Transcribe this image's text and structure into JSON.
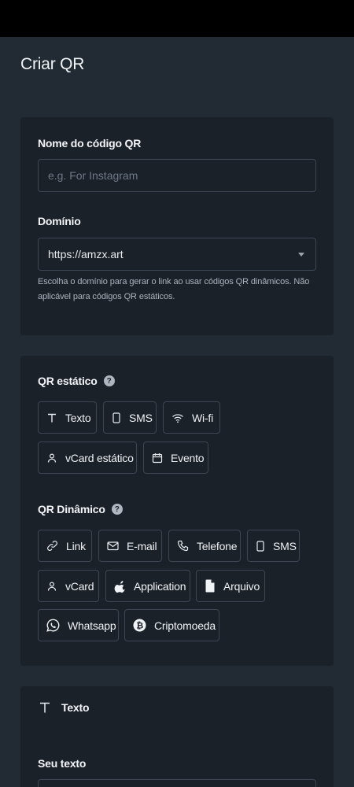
{
  "page": {
    "title": "Criar QR"
  },
  "form": {
    "name_label": "Nome do código QR",
    "name_placeholder": "e.g. For Instagram",
    "domain_label": "Domínio",
    "domain_value": "https://amzx.art",
    "domain_help": "Escolha o domínio para gerar o link ao usar códigos QR dinâmicos. Não aplicável para códigos QR estáticos."
  },
  "static_qr": {
    "title": "QR estático",
    "help_icon": "question-icon",
    "types": [
      {
        "label": "Texto",
        "icon": "text-icon"
      },
      {
        "label": "SMS",
        "icon": "phone-icon"
      },
      {
        "label": "Wi-fi",
        "icon": "wifi-icon"
      },
      {
        "label": "vCard estático",
        "icon": "user-icon"
      },
      {
        "label": "Evento",
        "icon": "calendar-icon"
      }
    ]
  },
  "dynamic_qr": {
    "title": "QR Dinâmico",
    "help_icon": "question-icon",
    "types": [
      {
        "label": "Link",
        "icon": "link-icon"
      },
      {
        "label": "E-mail",
        "icon": "mail-icon"
      },
      {
        "label": "Telefone",
        "icon": "phone-call-icon"
      },
      {
        "label": "SMS",
        "icon": "phone-icon"
      },
      {
        "label": "vCard",
        "icon": "user-icon"
      },
      {
        "label": "Application",
        "icon": "apple-icon"
      },
      {
        "label": "Arquivo",
        "icon": "file-icon"
      },
      {
        "label": "Whatsapp",
        "icon": "whatsapp-icon"
      },
      {
        "label": "Criptomoeda",
        "icon": "bitcoin-icon"
      }
    ]
  },
  "text_section": {
    "title": "Texto",
    "icon": "text-icon",
    "field_label": "Seu texto"
  }
}
